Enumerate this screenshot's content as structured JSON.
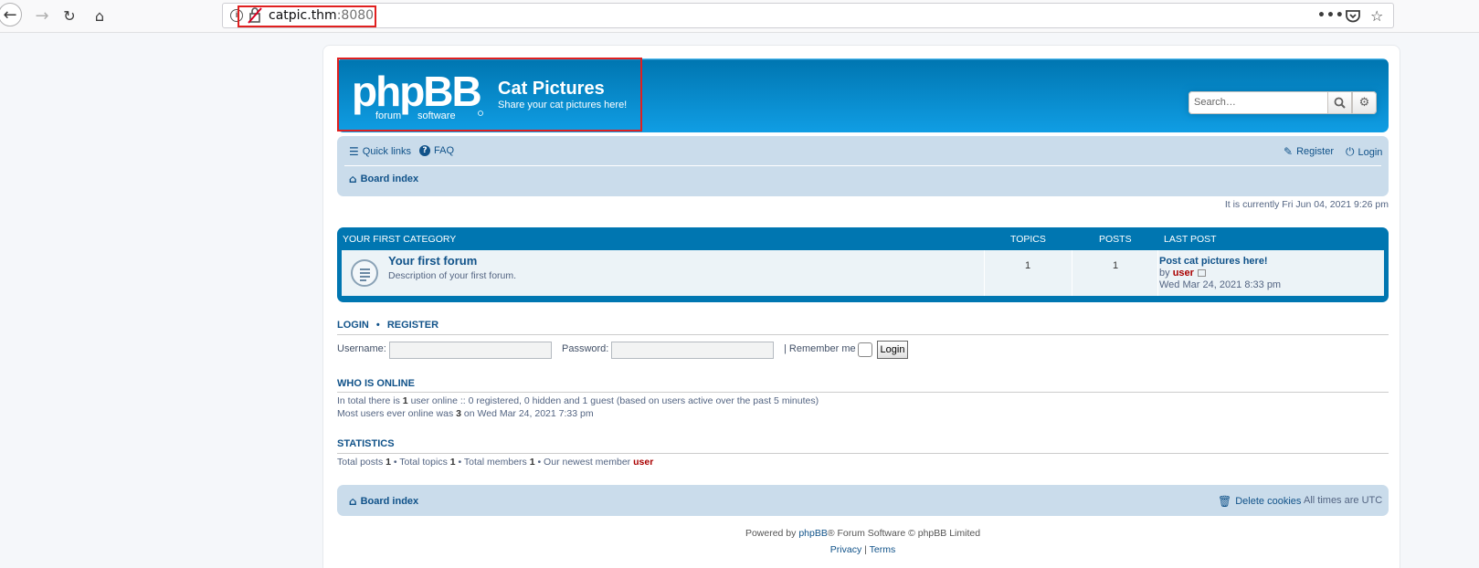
{
  "browser": {
    "url_host": "catpic.thm",
    "url_port": ":8080"
  },
  "header": {
    "site_title": "Cat Pictures",
    "site_description": "Share your cat pictures here!",
    "logo_main": "phpBB",
    "logo_sub_left": "forum",
    "logo_sub_right": "software",
    "search_placeholder": "Search…"
  },
  "navbar": {
    "quick_links": "Quick links",
    "faq": "FAQ",
    "register": "Register",
    "login": "Login",
    "board_index": "Board index"
  },
  "current_time": "It is currently Fri Jun 04, 2021 9:26 pm",
  "forum_table": {
    "category": "YOUR FIRST CATEGORY",
    "col_topics": "TOPICS",
    "col_posts": "POSTS",
    "col_last_post": "LAST POST",
    "forum": {
      "name": "Your first forum",
      "description": "Description of your first forum.",
      "topics": "1",
      "posts": "1",
      "last_post_title": "Post cat pictures here!",
      "last_post_by": "by",
      "last_post_user": "user",
      "last_post_date": "Wed Mar 24, 2021 8:33 pm"
    }
  },
  "login_section": {
    "title_login": "LOGIN",
    "separator": "•",
    "title_register": "REGISTER",
    "username_label": "Username:",
    "password_label": "Password:",
    "remember_label": "| Remember me",
    "login_button": "Login"
  },
  "who_is_online": {
    "title": "WHO IS ONLINE",
    "line1_pre": "In total there is",
    "line1_count": "1",
    "line1_post": "user online :: 0 registered, 0 hidden and 1 guest (based on users active over the past 5 minutes)",
    "line2_pre": "Most users ever online was",
    "line2_count": "3",
    "line2_post": "on Wed Mar 24, 2021 7:33 pm"
  },
  "statistics": {
    "title": "STATISTICS",
    "posts_label": "Total posts",
    "posts": "1",
    "topics_label": "• Total topics",
    "topics": "1",
    "members_label": "• Total members",
    "members": "1",
    "newest_label": "• Our newest member",
    "newest_user": "user"
  },
  "footer": {
    "board_index": "Board index",
    "delete_cookies": "Delete cookies",
    "timezone": "All times are UTC",
    "powered_pre": "Powered by",
    "powered_link": "phpBB",
    "powered_post": "® Forum Software © phpBB Limited",
    "privacy": "Privacy",
    "terms": "Terms",
    "link_separator": "|"
  }
}
